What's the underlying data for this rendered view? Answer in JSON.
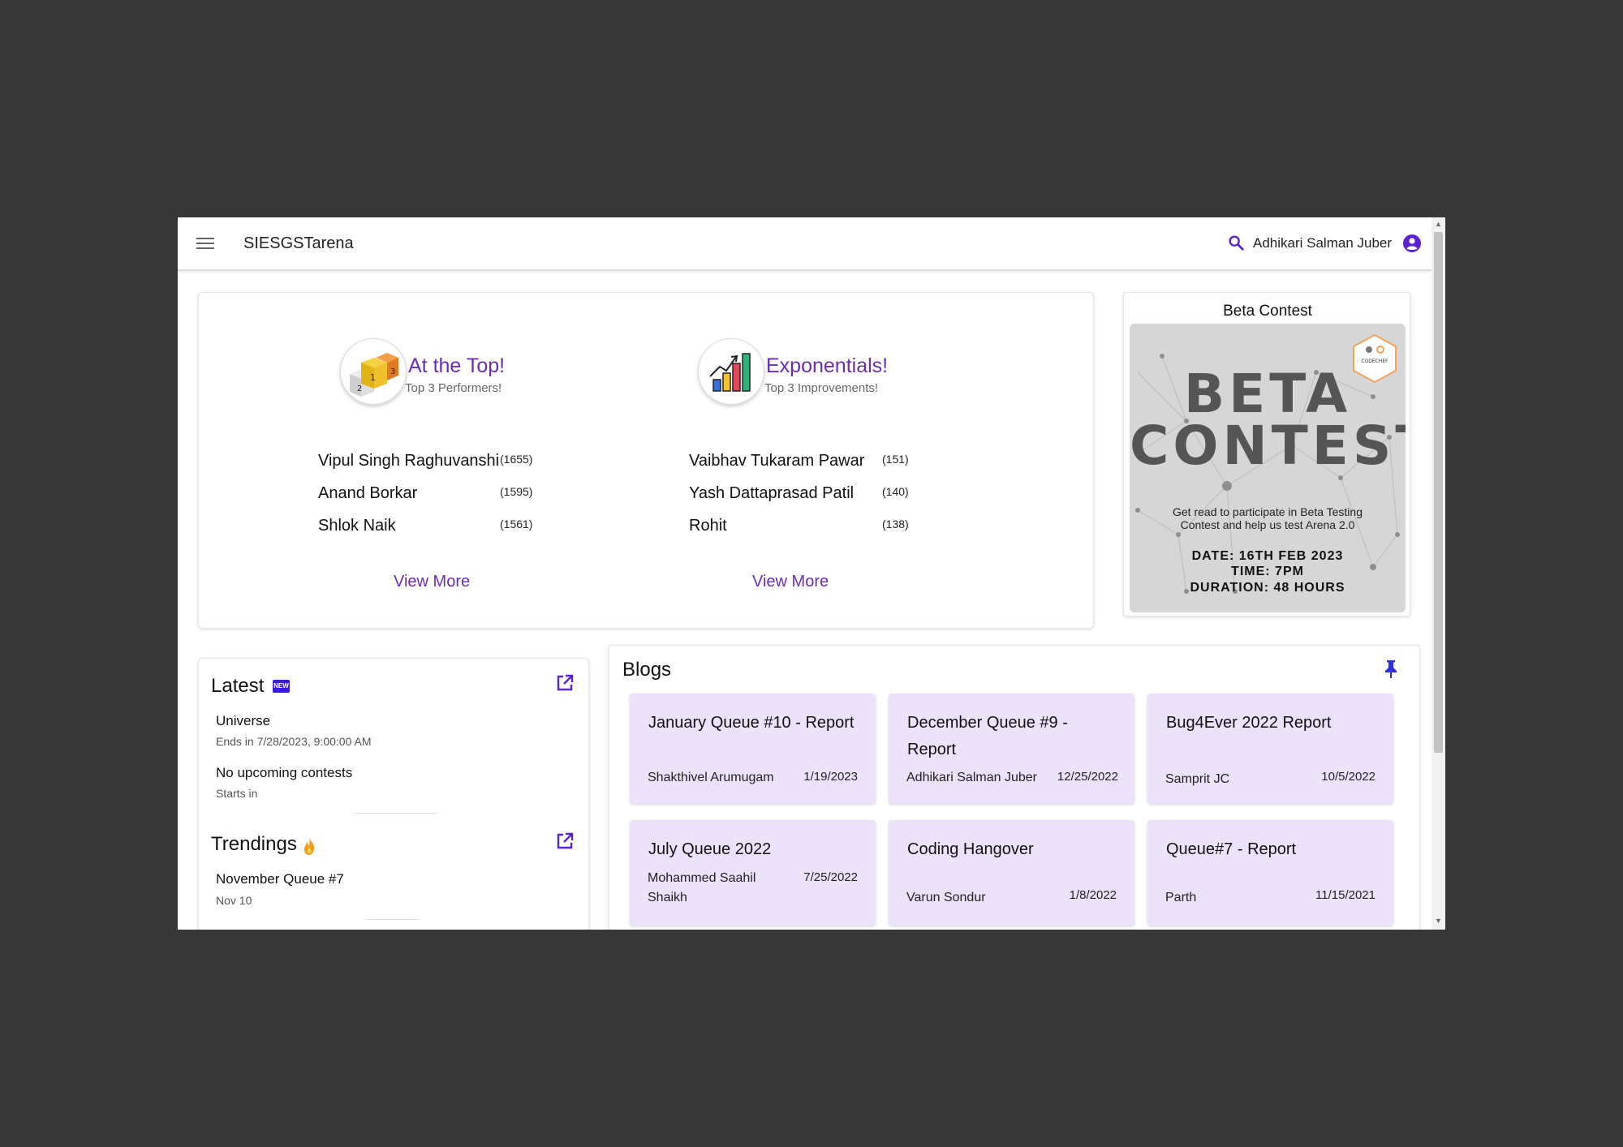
{
  "app": {
    "brand": "SIESGSTarena",
    "user_name": "Adhikari Salman Juber"
  },
  "top_performers": {
    "title": "At the Top!",
    "subtitle": "Top 3 Performers!",
    "rows": [
      {
        "name": "Vipul Singh Raghuvanshi",
        "score": "(1655)"
      },
      {
        "name": "Anand Borkar",
        "score": "(1595)"
      },
      {
        "name": "Shlok Naik",
        "score": "(1561)"
      }
    ],
    "view_more": "View More"
  },
  "top_improvements": {
    "title": "Exponentials!",
    "subtitle": "Top 3 Improvements!",
    "rows": [
      {
        "name": "Vaibhav Tukaram Pawar",
        "score": "(151)"
      },
      {
        "name": "Yash Dattaprasad Patil",
        "score": "(140)"
      },
      {
        "name": "Rohit",
        "score": "(138)"
      }
    ],
    "view_more": "View More"
  },
  "contest": {
    "title": "Beta Contest",
    "poster_line1": "BETA",
    "poster_line2": "CONTEST",
    "poster_desc1": "Get read to participate in Beta Testing",
    "poster_desc2": "Contest and help us test Arena 2.0",
    "poster_date": "DATE: 16TH FEB 2023",
    "poster_time": "TIME: 7PM",
    "poster_duration": "DURATION: 48 HOURS",
    "logo_text": "CODECHEF"
  },
  "latest": {
    "title": "Latest",
    "badge": "NEW",
    "items": [
      {
        "title": "Universe",
        "sub": "Ends in 7/28/2023, 9:00:00 AM"
      },
      {
        "title": "No upcoming contests",
        "sub": "Starts in"
      }
    ]
  },
  "trendings": {
    "title": "Trendings",
    "items": [
      {
        "title": "November Queue #7",
        "sub": "Nov 10"
      }
    ]
  },
  "blogs": {
    "title": "Blogs",
    "items": [
      {
        "title": "January Queue #10 - Report",
        "author": "Shakthivel Arumugam",
        "date": "1/19/2023"
      },
      {
        "title": "December Queue #9 - Report",
        "author": "Adhikari Salman Juber",
        "date": "12/25/2022"
      },
      {
        "title": "Bug4Ever 2022 Report",
        "author": "Samprit JC",
        "date": "10/5/2022"
      },
      {
        "title": "July Queue 2022",
        "author": "Mohammed Saahil Shaikh",
        "date": "7/25/2022"
      },
      {
        "title": "Coding Hangover",
        "author": "Varun Sondur",
        "date": "1/8/2022"
      },
      {
        "title": "Queue#7 - Report",
        "author": "Parth",
        "date": "11/15/2021"
      }
    ]
  },
  "colors": {
    "accent": "#6a2db5",
    "card_purple": "#ece2fb",
    "backdrop": "#373737"
  }
}
